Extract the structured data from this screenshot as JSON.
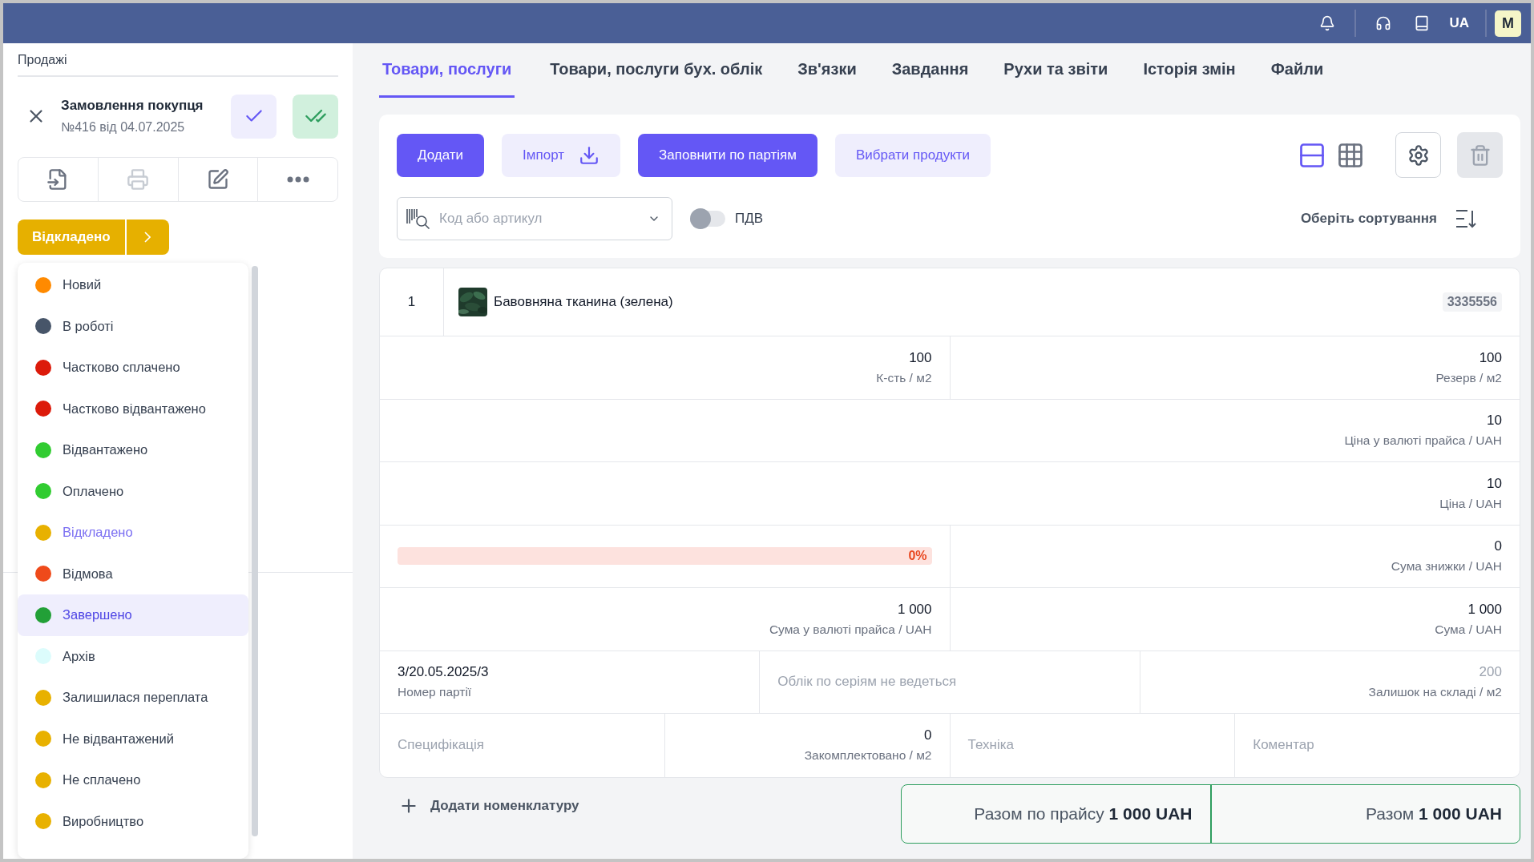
{
  "top_bar": {
    "language": "UA",
    "avatar": "M"
  },
  "sidebar": {
    "breadcrumb": "Продажі",
    "document": {
      "title": "Замовлення покупця",
      "subtitle": "№416 від 04.07.2025"
    },
    "actions": [
      {
        "kind": "export",
        "disabled": false
      },
      {
        "kind": "print",
        "disabled": true
      },
      {
        "kind": "edit",
        "disabled": false
      },
      {
        "kind": "more",
        "disabled": false
      }
    ],
    "status": {
      "label": "Відкладено",
      "color": "#e6b000",
      "expanded": true
    },
    "status_menu": [
      {
        "label": "Новий",
        "color": "#ff8a00",
        "selected": false,
        "highlighted": false
      },
      {
        "label": "В роботі",
        "color": "#475569",
        "selected": false,
        "highlighted": false
      },
      {
        "label": "Частково сплачено",
        "color": "#dc1a0a",
        "selected": false,
        "highlighted": false
      },
      {
        "label": "Частково відвантажено",
        "color": "#dc1a0a",
        "selected": false,
        "highlighted": false
      },
      {
        "label": "Відвантажено",
        "color": "#31cc31",
        "selected": false,
        "highlighted": false
      },
      {
        "label": "Оплачено",
        "color": "#31cc31",
        "selected": false,
        "highlighted": false
      },
      {
        "label": "Відкладено",
        "color": "#e8b100",
        "selected": true,
        "highlighted": false
      },
      {
        "label": "Відмова",
        "color": "#ef4a1a",
        "selected": false,
        "highlighted": false
      },
      {
        "label": "Завершено",
        "color": "#22a037",
        "selected": false,
        "highlighted": true
      },
      {
        "label": "Архів",
        "color": "#dcfcfc",
        "selected": false,
        "highlighted": false
      },
      {
        "label": "Залишилася переплата",
        "color": "#e8b100",
        "selected": false,
        "highlighted": false
      },
      {
        "label": "Не відвантажений",
        "color": "#e8b100",
        "selected": false,
        "highlighted": false
      },
      {
        "label": "Не сплачено",
        "color": "#e8b100",
        "selected": false,
        "highlighted": false
      },
      {
        "label": "Виробництво",
        "color": "#e8b100",
        "selected": false,
        "highlighted": false
      }
    ]
  },
  "tabs": [
    {
      "label": "Товари, послуги",
      "selected": true
    },
    {
      "label": "Товари, послуги бух. облік",
      "selected": false
    },
    {
      "label": "Зв'язки",
      "selected": false
    },
    {
      "label": "Завдання",
      "selected": false
    },
    {
      "label": "Рухи та звіти",
      "selected": false
    },
    {
      "label": "Історія змін",
      "selected": false
    },
    {
      "label": "Файли",
      "selected": false
    }
  ],
  "toolbar": {
    "buttons": [
      {
        "label": "Додати",
        "kind": "primary"
      },
      {
        "label": "Імпорт",
        "kind": "import"
      },
      {
        "label": "Заповнити по партіям",
        "kind": "primary"
      },
      {
        "label": "Вибрати продукти",
        "kind": "secondary"
      }
    ],
    "views": [
      {
        "kind": "rows",
        "selected": true
      },
      {
        "kind": "grid",
        "selected": false
      }
    ],
    "delete_disabled": true,
    "search": {
      "placeholder": "Код або артикул"
    },
    "vat": {
      "label": "ПДВ",
      "on": false
    },
    "sort": {
      "label": "Оберіть сортування"
    }
  },
  "product": {
    "index": "1",
    "name": "Бавовняна тканина (зелена)",
    "code": "3335556",
    "sections": [
      {
        "fields": [
          {
            "kind": "value",
            "value": "100",
            "label": "К-сть / м2"
          },
          {
            "kind": "value",
            "value": "100",
            "label": "Резерв / м2"
          }
        ]
      },
      {
        "fields": [
          {
            "kind": "value",
            "value": "10",
            "label": "Ціна у валюті прайса / UAH"
          }
        ]
      },
      {
        "fields": [
          {
            "kind": "value",
            "value": "10",
            "label": "Ціна / UAH"
          }
        ]
      },
      {
        "fields": [
          {
            "kind": "progress",
            "text": "0%",
            "level": 0
          },
          {
            "kind": "value",
            "value": "0",
            "label": "Сума знижки / UAH"
          }
        ]
      },
      {
        "fields": [
          {
            "kind": "value",
            "value": "1 000",
            "label": "Сума у валюті прайса / UAH"
          },
          {
            "kind": "value",
            "value": "1 000",
            "label": "Сума / UAH"
          }
        ]
      },
      {
        "fields": [
          {
            "kind": "left_value",
            "value": "3/20.05.2025/3",
            "label": "Номер партії"
          },
          {
            "kind": "placeholder",
            "placeholder": "Облік по серіям не ведеться"
          },
          {
            "kind": "value",
            "value": "200",
            "label": "Залишок на складі / м2",
            "muted": true
          }
        ]
      },
      {
        "fields": [
          {
            "kind": "placeholder",
            "placeholder": "Специфікація"
          },
          {
            "kind": "value",
            "value": "0",
            "label": "Закомплектовано / м2"
          },
          {
            "kind": "placeholder",
            "placeholder": "Техніка"
          },
          {
            "kind": "placeholder",
            "placeholder": "Коментар"
          }
        ]
      }
    ]
  },
  "add_link": "Додати номенклатуру",
  "totals": [
    "Разом по прайсу **1 000 UAH**",
    "Разом **1 000 UAH**"
  ]
}
